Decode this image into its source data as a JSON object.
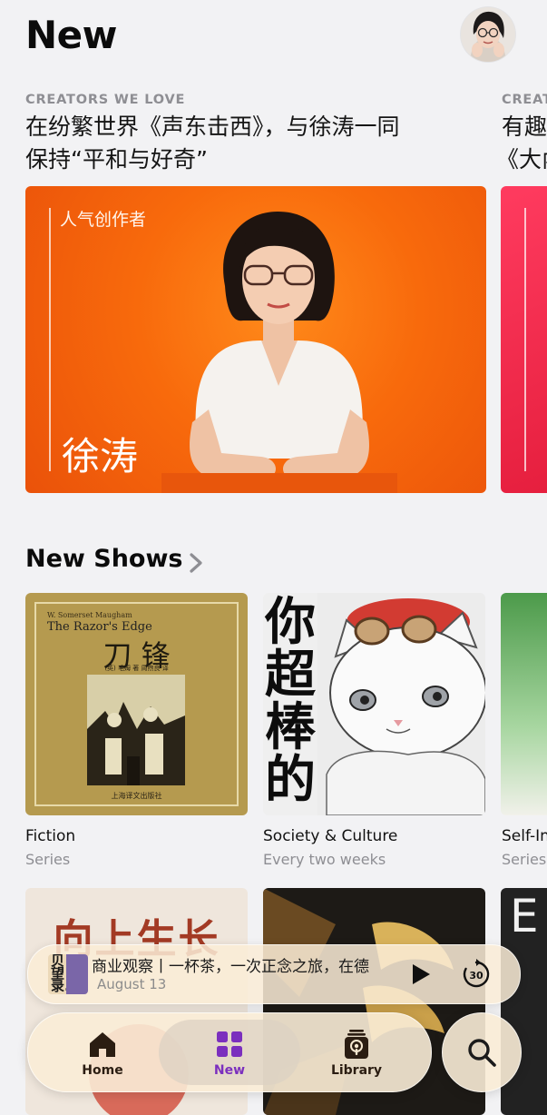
{
  "header": {
    "title": "New"
  },
  "featured": {
    "items": [
      {
        "eyebrow": "CREATORS WE LOVE",
        "title_line1": "在纷繁世界《声东击西》，与徐涛一同",
        "title_line2": "保持“平和与好奇”",
        "card_tag": "人气创作者",
        "card_name": "徐涛"
      },
      {
        "eyebrow": "CREAT",
        "title_line1": "有趣",
        "title_line2": "《大內"
      }
    ]
  },
  "section": {
    "title": "New Shows"
  },
  "shows": [
    {
      "title": "Fiction",
      "subtitle": "Series",
      "art": {
        "author": "W. Somerset Maugham",
        "en_title": "The Razor's Edge",
        "cn_title": "刀 锋",
        "credits": "(英) 毛姆 著   周煦良 译",
        "publisher": "上海译文出版社"
      }
    },
    {
      "title": "Society & Culture",
      "subtitle": "Every two weeks",
      "art": {
        "text": [
          "你",
          "超",
          "棒",
          "的"
        ]
      }
    },
    {
      "title": "Self-In",
      "subtitle": "Series"
    }
  ],
  "row2": {
    "tile1_text": "向上生长",
    "tile3_letter": "E"
  },
  "player": {
    "art_text": [
      "贝",
      "望",
      "录."
    ],
    "title": "商业观察丨一杯茶，一次正念之旅，在德",
    "date": "August 13",
    "skip_seconds": "30"
  },
  "tabs": [
    {
      "label": "Home",
      "icon": "home-icon"
    },
    {
      "label": "New",
      "icon": "grid-icon",
      "selected": true
    },
    {
      "label": "Library",
      "icon": "library-icon"
    }
  ],
  "colors": {
    "accent": "#7b2fbe",
    "tab_ink": "#2b1d12",
    "featured_bg": "#f86a0c"
  }
}
